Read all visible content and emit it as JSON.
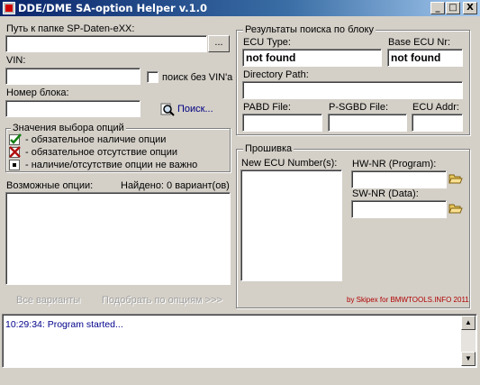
{
  "window": {
    "title": "DDE/DME SA-option Helper  v.1.0",
    "controls": {
      "minimize": "_",
      "maximize": "□",
      "close": "X"
    }
  },
  "left": {
    "path_label": "Путь к папке SP-Daten-eXX:",
    "path_value": "",
    "browse_label": "...",
    "vin_label": "VIN:",
    "vin_value": "",
    "search_without_vin_label": "поиск без VIN'a",
    "block_label": "Номер блока:",
    "block_value": "",
    "search_link": "Поиск...",
    "legend": {
      "title": "Значения выбора опций",
      "items": [
        {
          "icon": "check-icon",
          "text": "- обязательное наличие опции"
        },
        {
          "icon": "cross-icon",
          "text": "- обязательное отсутствие опции"
        },
        {
          "icon": "dot-icon",
          "text": "- наличие/отсутствие опции не важно"
        }
      ]
    },
    "options_label": "Возможные опции:",
    "found_label": "Найдено: 0 вариант(ов)",
    "all_variants_button": "Все варианты",
    "match_button": "Подобрать по опциям >>>"
  },
  "results": {
    "title": "Результаты поиска по блоку",
    "ecu_type_label": "ECU Type:",
    "ecu_type_value": "not found",
    "base_ecu_label": "Base ECU Nr:",
    "base_ecu_value": "not found",
    "directory_label": "Directory Path:",
    "directory_value": "",
    "pabd_label": "PABD File:",
    "psgbd_label": "P-SGBD File:",
    "ecu_addr_label": "ECU Addr:"
  },
  "firmware": {
    "title": "Прошивка",
    "new_ecu_label": "New ECU Number(s):",
    "hw_label": "HW-NR (Program):",
    "sw_label": "SW-NR (Data):",
    "credit": "by Skipex for BMWTOOLS.INFO 2011"
  },
  "log": {
    "lines": [
      "10:29:34:  Program started..."
    ]
  },
  "colors": {
    "face": "#d4d0c8",
    "title_start": "#0a246a",
    "log_text": "#00008b",
    "credit": "#b00000"
  }
}
